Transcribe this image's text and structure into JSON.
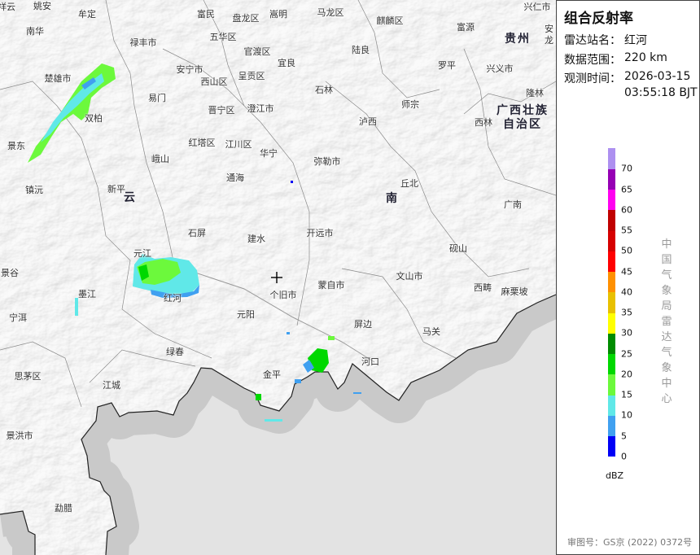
{
  "panel": {
    "title": "组合反射率",
    "station_label": "雷达站名：",
    "station": "红河",
    "range_label": "数据范围：",
    "range": "220 km",
    "time_label": "观测时间：",
    "date": "2026-03-15",
    "time": "03:55:18 BJT",
    "unit": "dBZ",
    "source": "中国气象局雷达气象中心",
    "approval": "审图号：GS京 (2022) 0372号"
  },
  "colorbar": {
    "ticks": [
      "0",
      "5",
      "10",
      "15",
      "20",
      "25",
      "30",
      "35",
      "40",
      "45",
      "50",
      "55",
      "60",
      "65",
      "70"
    ],
    "colors": [
      "#0000f6",
      "#40a0f0",
      "#60e8e8",
      "#6cf93c",
      "#00d800",
      "#008c00",
      "#ffff00",
      "#e8c000",
      "#ff9000",
      "#ff0000",
      "#d60000",
      "#c00000",
      "#ff00f0",
      "#9600b4",
      "#ad90f0"
    ]
  },
  "map": {
    "provinces": [
      "云",
      "南",
      "贵州",
      "广西壮族",
      "自治区"
    ],
    "labels": [
      "祥云",
      "姚安",
      "牟定",
      "南华",
      "禄丰市",
      "富民",
      "盘龙区",
      "嵩明",
      "马龙区",
      "麒麟区",
      "兴仁市",
      "富源",
      "安龙",
      "五华区",
      "官渡区",
      "陆良",
      "宜良",
      "罗平",
      "兴义市",
      "安宁市",
      "楚雄市",
      "西山区",
      "呈贡区",
      "石林",
      "隆林",
      "易门",
      "晋宁区",
      "澄江市",
      "师宗",
      "西林",
      "泸西",
      "双柏",
      "红塔区",
      "江川区",
      "华宁",
      "景东",
      "峨山",
      "弥勒市",
      "通海",
      "丘北",
      "镇沅",
      "新平",
      "广南",
      "石屏",
      "建水",
      "开远市",
      "砚山",
      "元江",
      "景谷",
      "文山市",
      "蒙自市",
      "个旧市",
      "西畴",
      "麻栗坡",
      "墨江",
      "红河",
      "宁洱",
      "元阳",
      "屏边",
      "马关",
      "绿春",
      "河口",
      "思茅区",
      "金平",
      "江城",
      "景洪市",
      "勐腊"
    ]
  }
}
